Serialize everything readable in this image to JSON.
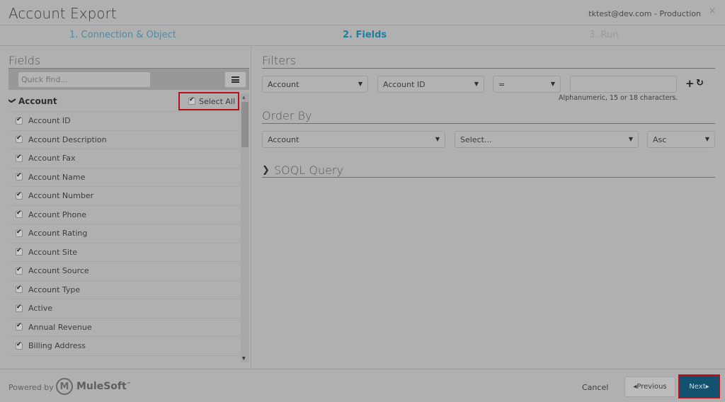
{
  "header": {
    "title": "Account Export",
    "account": "tktest@dev.com - Production",
    "close_icon": "×"
  },
  "steps": [
    {
      "label": "1. Connection & Object",
      "state": "completed"
    },
    {
      "label": "2. Fields",
      "state": "active"
    },
    {
      "label": "3. Run",
      "state": "upcoming"
    }
  ],
  "fields_panel": {
    "heading": "Fields",
    "quick_find_placeholder": "Quick find...",
    "menu_icon": "hamburger-menu-icon",
    "group": {
      "label": "Account",
      "chevron": "❯",
      "expanded": true,
      "select_all_label": "Select All",
      "select_all_checked": true
    },
    "items": [
      {
        "label": "Account ID",
        "checked": true
      },
      {
        "label": "Account Description",
        "checked": true
      },
      {
        "label": "Account Fax",
        "checked": true
      },
      {
        "label": "Account Name",
        "checked": true
      },
      {
        "label": "Account Number",
        "checked": true
      },
      {
        "label": "Account Phone",
        "checked": true
      },
      {
        "label": "Account Rating",
        "checked": true
      },
      {
        "label": "Account Site",
        "checked": true
      },
      {
        "label": "Account Source",
        "checked": true
      },
      {
        "label": "Account Type",
        "checked": true
      },
      {
        "label": "Active",
        "checked": true
      },
      {
        "label": "Annual Revenue",
        "checked": true
      },
      {
        "label": "Billing Address",
        "checked": true
      }
    ]
  },
  "filters": {
    "heading": "Filters",
    "object_select": "Account",
    "field_select": "Account ID",
    "operator_select": "=",
    "value": "",
    "hint": "Alphanumeric, 15 or 18 characters.",
    "add_icon": "+",
    "refresh_icon": "↻"
  },
  "order_by": {
    "heading": "Order By",
    "object_select": "Account",
    "field_select": "Select...",
    "direction_select": "Asc"
  },
  "soql": {
    "heading": "SOQL Query",
    "expanded": false
  },
  "footer": {
    "powered_by": "Powered by",
    "brand": "MuleSoft",
    "brand_mark": "M",
    "trademark": "™",
    "cancel": "Cancel",
    "previous": "◂Previous",
    "next": "Next▸"
  }
}
